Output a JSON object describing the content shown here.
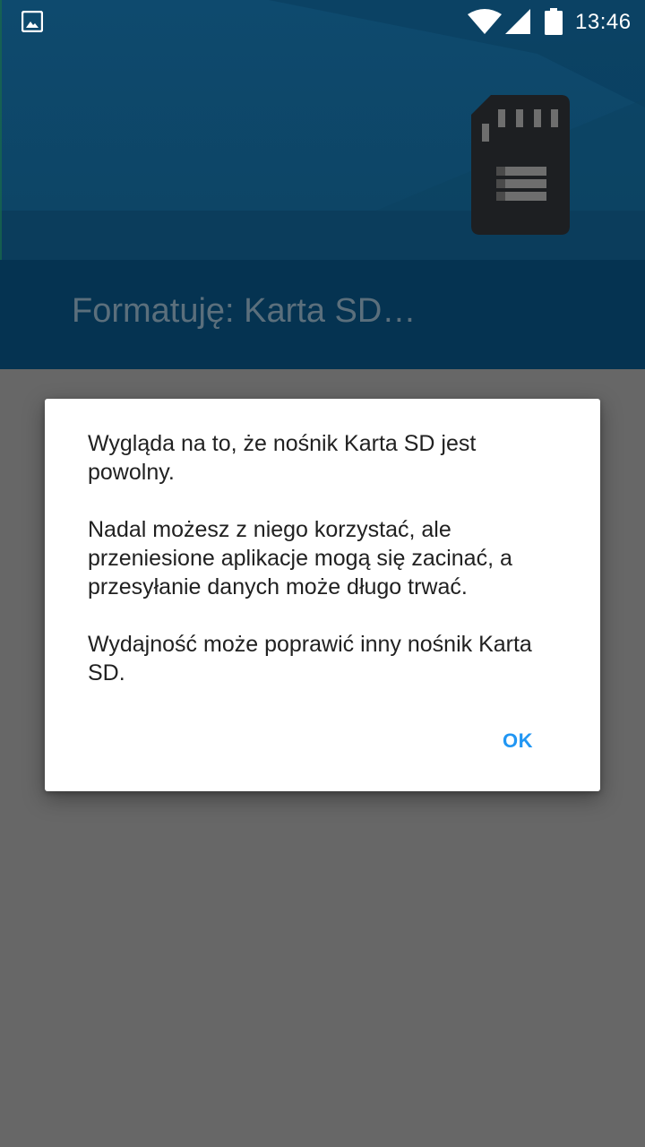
{
  "status_bar": {
    "time": "13:46",
    "icons": [
      "gallery-icon",
      "wifi-icon",
      "signal-icon",
      "battery-icon"
    ]
  },
  "header": {
    "title": "Formatuję: Karta SD…",
    "icon": "sd-card-icon"
  },
  "dialog": {
    "paragraphs": [
      "Wygląda na to, że nośnik Karta SD jest powolny.",
      "Nadal możesz z niego korzystać, ale przeniesione aplikacje mogą się zacinać, a przesyłanie danych może długo trwać.",
      "Wydajność może poprawić inny nośnik Karta SD."
    ],
    "ok_label": "OK"
  },
  "colors": {
    "accent": "#2196f3",
    "header_bg": "#0d4363",
    "scrim_bg": "#676767"
  }
}
